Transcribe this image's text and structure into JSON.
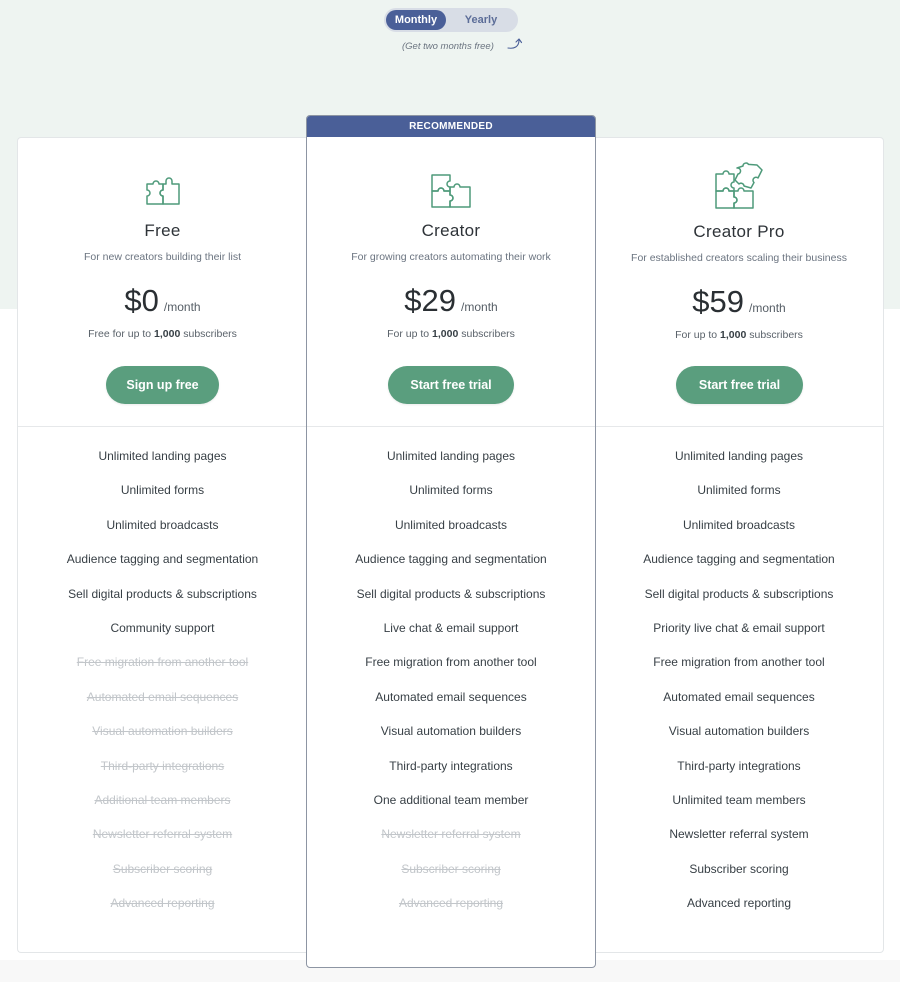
{
  "billing_toggle": {
    "options": [
      "Monthly",
      "Yearly"
    ],
    "selected": "Monthly",
    "promo_text": "(Get two months free)"
  },
  "colors": {
    "accent_blue": "#4a5f98",
    "cta_green": "#5a9e7e",
    "icon_green": "#4e9a7a",
    "band_bg": "#eef4f1"
  },
  "plans": [
    {
      "name": "Free",
      "icon": "puzzle-two-pieces-icon",
      "description": "For new creators building their list",
      "price": "$0",
      "period": "/month",
      "subscriber_note_prefix": "Free for up to ",
      "subscriber_count": "1,000",
      "subscriber_note_suffix": " subscribers",
      "cta_label": "Sign up free",
      "recommended": false,
      "features": [
        {
          "label": "Unlimited landing pages",
          "included": true
        },
        {
          "label": "Unlimited forms",
          "included": true
        },
        {
          "label": "Unlimited broadcasts",
          "included": true
        },
        {
          "label": "Audience tagging and segmentation",
          "included": true
        },
        {
          "label": "Sell digital products & subscriptions",
          "included": true
        },
        {
          "label": "Community support",
          "included": true
        },
        {
          "label": "Free migration from another tool",
          "included": false
        },
        {
          "label": "Automated email sequences",
          "included": false
        },
        {
          "label": "Visual automation builders",
          "included": false
        },
        {
          "label": "Third-party integrations",
          "included": false
        },
        {
          "label": "Additional team members",
          "included": false
        },
        {
          "label": "Newsletter referral system",
          "included": false
        },
        {
          "label": "Subscriber scoring",
          "included": false
        },
        {
          "label": "Advanced reporting",
          "included": false
        }
      ]
    },
    {
      "name": "Creator",
      "icon": "puzzle-three-pieces-icon",
      "description": "For growing creators automating their work",
      "price": "$29",
      "period": "/month",
      "subscriber_note_prefix": "For up to ",
      "subscriber_count": "1,000",
      "subscriber_note_suffix": " subscribers",
      "cta_label": "Start free trial",
      "recommended": true,
      "recommended_label": "RECOMMENDED",
      "features": [
        {
          "label": "Unlimited landing pages",
          "included": true
        },
        {
          "label": "Unlimited forms",
          "included": true
        },
        {
          "label": "Unlimited broadcasts",
          "included": true
        },
        {
          "label": "Audience tagging and segmentation",
          "included": true
        },
        {
          "label": "Sell digital products & subscriptions",
          "included": true
        },
        {
          "label": "Live chat & email support",
          "included": true
        },
        {
          "label": "Free migration from another tool",
          "included": true
        },
        {
          "label": "Automated email sequences",
          "included": true
        },
        {
          "label": "Visual automation builders",
          "included": true
        },
        {
          "label": "Third-party integrations",
          "included": true
        },
        {
          "label": "One additional team member",
          "included": true
        },
        {
          "label": "Newsletter referral system",
          "included": false
        },
        {
          "label": "Subscriber scoring",
          "included": false
        },
        {
          "label": "Advanced reporting",
          "included": false
        }
      ]
    },
    {
      "name": "Creator Pro",
      "icon": "puzzle-four-pieces-icon",
      "description": "For established creators scaling their business",
      "price": "$59",
      "period": "/month",
      "subscriber_note_prefix": "For up to ",
      "subscriber_count": "1,000",
      "subscriber_note_suffix": " subscribers",
      "cta_label": "Start free trial",
      "recommended": false,
      "features": [
        {
          "label": "Unlimited landing pages",
          "included": true
        },
        {
          "label": "Unlimited forms",
          "included": true
        },
        {
          "label": "Unlimited broadcasts",
          "included": true
        },
        {
          "label": "Audience tagging and segmentation",
          "included": true
        },
        {
          "label": "Sell digital products & subscriptions",
          "included": true
        },
        {
          "label": "Priority live chat & email support",
          "included": true
        },
        {
          "label": "Free migration from another tool",
          "included": true
        },
        {
          "label": "Automated email sequences",
          "included": true
        },
        {
          "label": "Visual automation builders",
          "included": true
        },
        {
          "label": "Third-party integrations",
          "included": true
        },
        {
          "label": "Unlimited team members",
          "included": true
        },
        {
          "label": "Newsletter referral system",
          "included": true
        },
        {
          "label": "Subscriber scoring",
          "included": true
        },
        {
          "label": "Advanced reporting",
          "included": true
        }
      ]
    }
  ]
}
